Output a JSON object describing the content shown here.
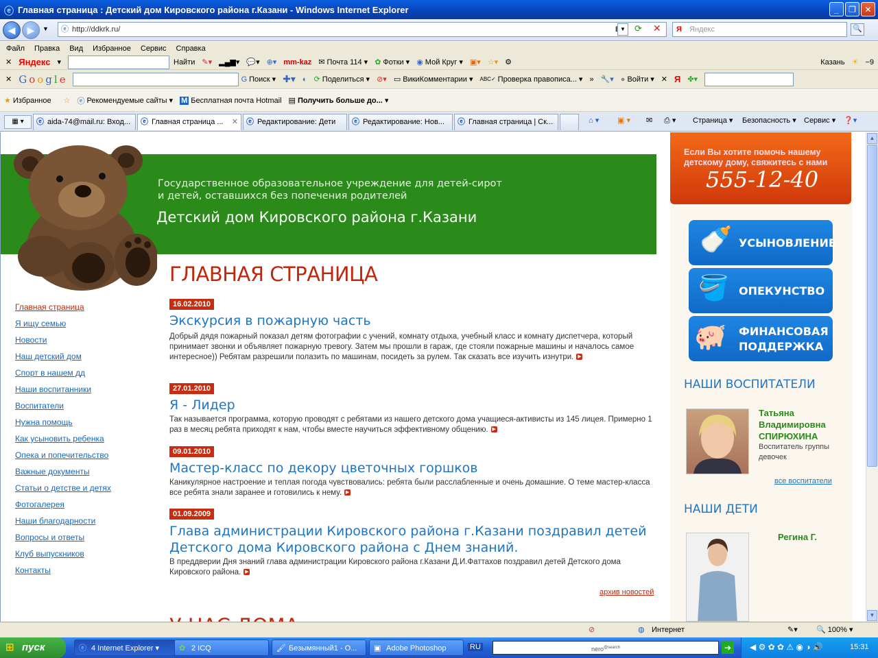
{
  "window": {
    "title": "Главная страница : Детский дом Кировского района г.Казани - Windows Internet Explorer"
  },
  "address": {
    "url": "http://ddkrk.ru/",
    "lang": "En",
    "search_placeholder": "Яндекс"
  },
  "menu": [
    "Файл",
    "Правка",
    "Вид",
    "Избранное",
    "Сервис",
    "Справка"
  ],
  "yandex_bar": {
    "logo": "Яндекс",
    "find": "Найти",
    "mail_logo": "mm-kaz",
    "mail": "Почта 114",
    "photos": "Фотки",
    "mycircle": "Мой Круг",
    "city": "Казань",
    "temp": "−9"
  },
  "google_bar": {
    "search": "Поиск",
    "share": "Поделиться",
    "wiki": "ВикиКомментарии",
    "spell": "Проверка правописа...",
    "login": "Войти"
  },
  "favorites_bar": {
    "fav": "Избранное",
    "recommended": "Рекомендуемые сайты",
    "hotmail": "Бесплатная почта Hotmail",
    "more": "Получить больше до..."
  },
  "tabs": [
    "aida-74@mail.ru: Вход...",
    "Главная страница ...",
    "Редактирование: Дети",
    "Редактирование: Нов...",
    "Главная страница | Ск..."
  ],
  "commands": {
    "page": "Страница",
    "security": "Безопасность",
    "service": "Сервис"
  },
  "banner": {
    "line1": "Государственное образовательное учреждение для детей-сирот",
    "line2": "и детей, оставшихся без попечения родителей",
    "title": "Детский дом Кировского района г.Казани"
  },
  "nav": [
    "Главная страница",
    "Я ищу семью",
    "Новости",
    "Наш детский дом",
    "Спорт в нашем дд",
    "Наши воспитанники",
    "Воспитатели",
    "Нужна помощь",
    "Как усыновить ребенка",
    "Опека и попечительство",
    "Важные документы",
    "Статьи о детстве и детях",
    "Фотогалерея",
    "Наши благодарности",
    "Вопросы и ответы",
    "Клуб выпускников",
    "Контакты"
  ],
  "page_title": "ГЛАВНАЯ СТРАНИЦА",
  "news": [
    {
      "date": "16.02.2010",
      "title": "Экскурсия в пожарную часть",
      "text": "Добрый дядя пожарный показал детям фотографии с учений, комнату отдыха, учебный класс и комнату диспетчера, который принимает звонки и объявляет пожарную тревогу. Затем мы прошли в гараж, где стояли пожарные машины и началось самое интересное)) Ребятам разрешили полазить по машинам, посидеть за рулем. Так сказать все изучить изнутри."
    },
    {
      "date": "27.01.2010",
      "title": "Я - Лидер",
      "text": "Так называется программа, которую проводят с ребятами из нашего детского дома учащиеся-активисты из 145 лицея. Примерно 1 раз в месяц ребята приходят к нам, чтобы вместе научиться эффективному общению."
    },
    {
      "date": "09.01.2010",
      "title": "Мастер-класс по декору цветочных горшков",
      "text": "Каникулярное настроение и теплая погода чувствовались: ребята были расслабленные и очень домашние. О теме мастер-класса все ребята знали заранее и готовились к нему."
    },
    {
      "date": "01.09.2009",
      "title": "Глава администрации Кировского района г.Казани поздравил детей Детского дома Кировского района с Днем знаний.",
      "text": "В преддверии Дня знаний глава администрации Кировского района г.Казани Д.И.Фаттахов поздравил детей Детского дома Кировского района."
    }
  ],
  "archive": "архив новостей",
  "next_section": "У НАС ДОМА",
  "help": {
    "text": "Если Вы хотите помочь нашему детскому дому, свяжитесь с нами",
    "phone": "555-12-40"
  },
  "buttons": [
    "УСЫНОВЛЕНИЕ",
    "ОПЕКУНСТВО",
    "ФИНАНСОВАЯ ПОДДЕРЖКА"
  ],
  "educators": {
    "heading": "НАШИ ВОСПИТАТЕЛИ",
    "name1": "Татьяна",
    "name2": "Владимировна",
    "name3": "СПИРЮХИНА",
    "role": "Воспитатель группы девочек",
    "all": "все воспитатели"
  },
  "children": {
    "heading": "НАШИ ДЕТИ",
    "name": "Регина Г."
  },
  "status": {
    "zone": "Интернет",
    "zoom": "100%"
  },
  "taskbar": {
    "start": "пуск",
    "ie": "4 Internet Explorer",
    "icq": "2 ICQ",
    "paint": "Безымянный1 - О...",
    "ps": "Adobe Photoshop",
    "lang": "RU",
    "time": "15:31"
  }
}
